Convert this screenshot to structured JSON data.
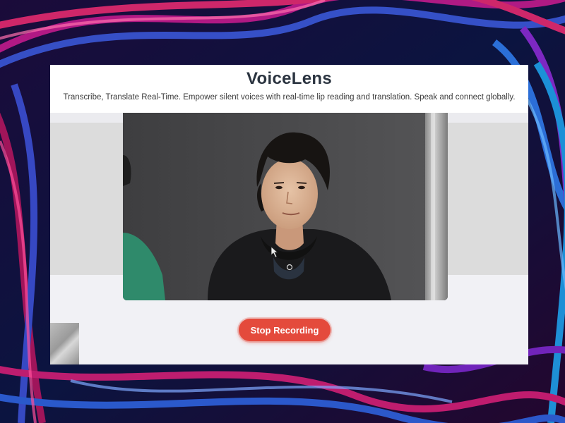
{
  "app": {
    "title": "VoiceLens",
    "tagline": "Transcribe, Translate Real-Time. Empower silent voices with real-time lip reading and translation. Speak and connect globally."
  },
  "controls": {
    "stop_label": "Stop Recording"
  },
  "colors": {
    "accent": "#e44a3c",
    "title": "#2b3440",
    "panel_bg": "#f1f1f5"
  }
}
